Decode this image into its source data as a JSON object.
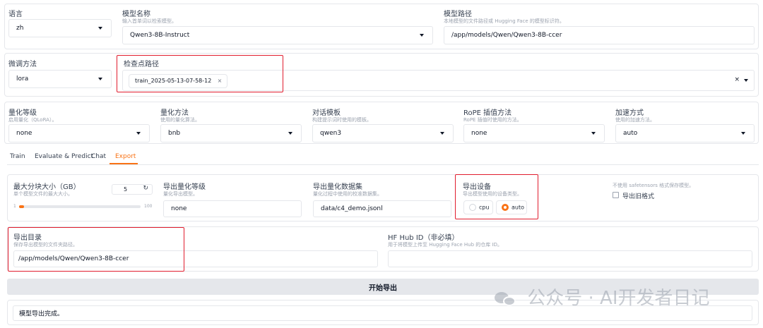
{
  "top_row": {
    "language": {
      "label": "语言",
      "value": "zh"
    },
    "model_name": {
      "label": "模型名称",
      "sublabel": "输入首单词以检索模型。",
      "value": "Qwen3-8B-Instruct"
    },
    "model_path": {
      "label": "模型路径",
      "sublabel": "本地模型的文件路径或 Hugging Face 的模型标识符。",
      "value": "/app/models/Qwen/Qwen3-8B-ccer"
    }
  },
  "second_row": {
    "finetune_method": {
      "label": "微调方法",
      "value": "lora"
    },
    "checkpoint_path": {
      "label": "检查点路径",
      "chip": "train_2025-05-13-07-58-12",
      "chip_close": "×",
      "clear": "×"
    }
  },
  "third_row": {
    "quant_bit": {
      "label": "量化等级",
      "sublabel": "启用量化（QLoRA）。",
      "value": "none"
    },
    "quant_method": {
      "label": "量化方法",
      "sublabel": "使用的量化算法。",
      "value": "bnb"
    },
    "template": {
      "label": "对话模板",
      "sublabel": "构建提示词时使用的模板。",
      "value": "qwen3"
    },
    "rope_scaling": {
      "label": "RoPE 插值方法",
      "sublabel": "RoPE 插值时使用的方法。",
      "value": "none"
    },
    "booster": {
      "label": "加速方式",
      "sublabel": "使用的加速方法。",
      "value": "auto"
    }
  },
  "tabs": [
    "Train",
    "Evaluate & Predict",
    "Chat",
    "Export"
  ],
  "active_tab": "Export",
  "export": {
    "size": {
      "label": "最大分块大小（GB）",
      "sublabel": "单个模型文件的最大大小。",
      "value": "5",
      "reset_icon": "↻",
      "min": "1",
      "max": "100",
      "fraction": 0.04
    },
    "quant_bit": {
      "label": "导出量化等级",
      "sublabel": "量化导出模型。",
      "value": "none"
    },
    "quant_dataset": {
      "label": "导出量化数据集",
      "sublabel": "量化过程中使用的校准数据集。",
      "value": "data/c4_demo.jsonl"
    },
    "device": {
      "label": "导出设备",
      "sublabel": "导出模型使用的设备类型。",
      "options": [
        "cpu",
        "auto"
      ],
      "selected": "auto"
    },
    "legacy": {
      "sublabel": "不使用 safetensors 格式保存模型。",
      "label": "导出旧格式"
    },
    "dir": {
      "label": "导出目录",
      "sublabel": "保存导出模型的文件夹路径。",
      "value": "/app/models/Qwen/Qwen3-8B-ccer"
    },
    "hub": {
      "label": "HF Hub ID（非必填）",
      "sublabel": "用于将模型上传至 Hugging Face Hub 的仓库 ID。",
      "value": ""
    },
    "start_button": "开始导出",
    "output": "模型导出完成。"
  },
  "watermark": "公众号 · AI开发者日记",
  "colors": {
    "accent": "#f97316",
    "highlight": "#e11d2e"
  }
}
